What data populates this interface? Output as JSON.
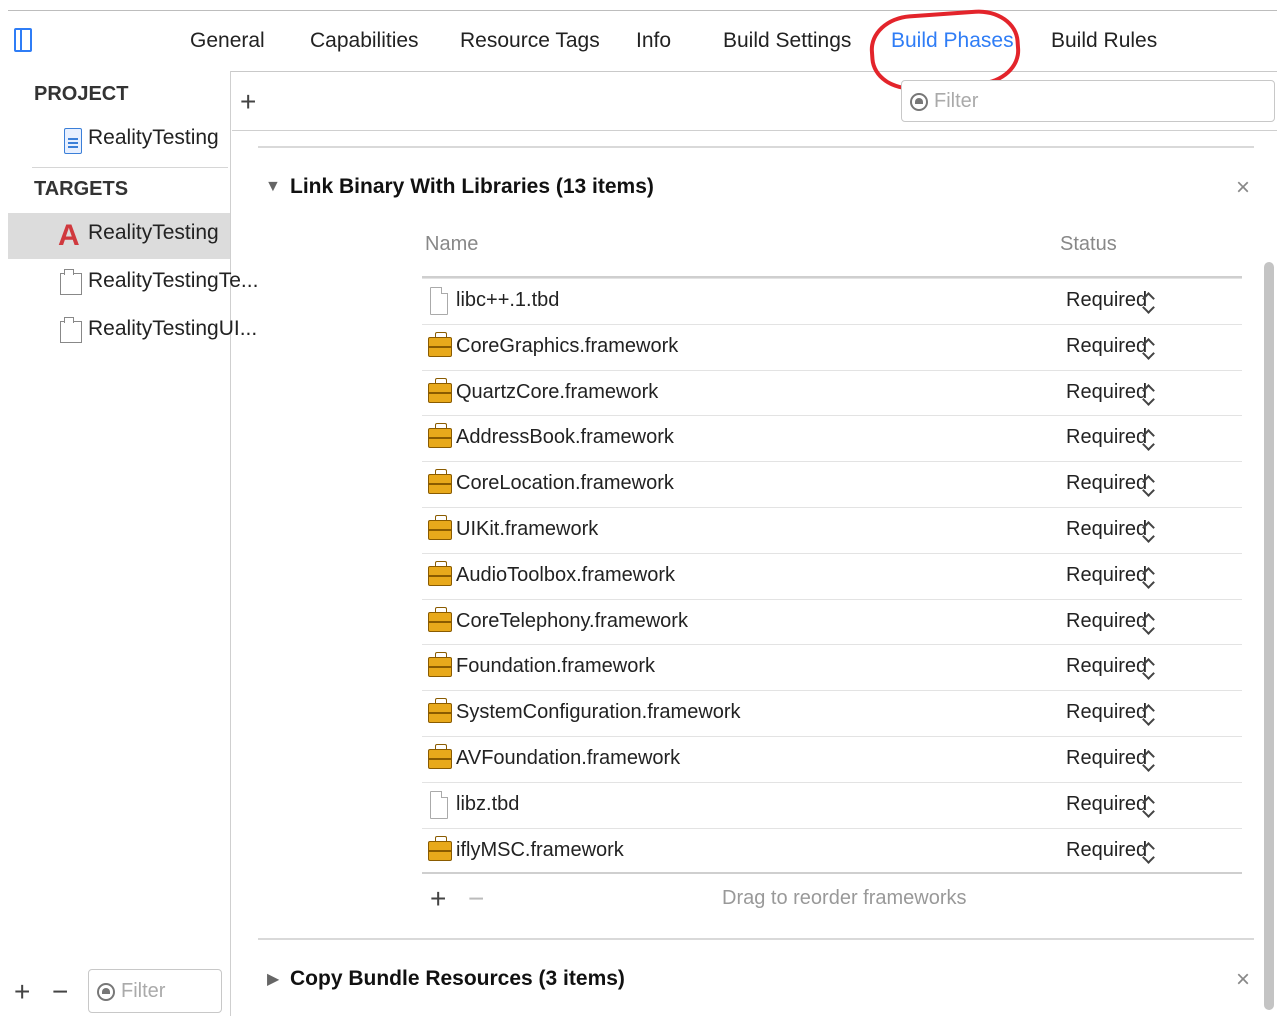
{
  "tabs": [
    {
      "label": "General"
    },
    {
      "label": "Capabilities"
    },
    {
      "label": "Resource Tags"
    },
    {
      "label": "Info"
    },
    {
      "label": "Build Settings"
    },
    {
      "label": "Build Phases",
      "active": true
    },
    {
      "label": "Build Rules"
    }
  ],
  "sidebar": {
    "project_header": "PROJECT",
    "project_name": "RealityTesting",
    "targets_header": "TARGETS",
    "targets": [
      {
        "label": "RealityTesting",
        "selected": true
      },
      {
        "label": "RealityTestingTe..."
      },
      {
        "label": "RealityTestingUI..."
      }
    ],
    "filter_placeholder": "Filter",
    "add_symbol": "+",
    "remove_symbol": "−"
  },
  "main": {
    "add_symbol": "+",
    "filter_placeholder": "Filter",
    "link_phase": {
      "title": "Link Binary With Libraries (13 items)",
      "close_symbol": "×",
      "col_name": "Name",
      "col_status": "Status",
      "items": [
        {
          "name": "libc++.1.tbd",
          "status": "Required",
          "icon": "file-icon"
        },
        {
          "name": "CoreGraphics.framework",
          "status": "Required",
          "icon": "framework-icon"
        },
        {
          "name": "QuartzCore.framework",
          "status": "Required",
          "icon": "framework-icon"
        },
        {
          "name": "AddressBook.framework",
          "status": "Required",
          "icon": "framework-icon"
        },
        {
          "name": "CoreLocation.framework",
          "status": "Required",
          "icon": "framework-icon"
        },
        {
          "name": "UIKit.framework",
          "status": "Required",
          "icon": "framework-icon"
        },
        {
          "name": "AudioToolbox.framework",
          "status": "Required",
          "icon": "framework-icon"
        },
        {
          "name": "CoreTelephony.framework",
          "status": "Required",
          "icon": "framework-icon"
        },
        {
          "name": "Foundation.framework",
          "status": "Required",
          "icon": "framework-icon"
        },
        {
          "name": "SystemConfiguration.framework",
          "status": "Required",
          "icon": "framework-icon"
        },
        {
          "name": "AVFoundation.framework",
          "status": "Required",
          "icon": "framework-icon"
        },
        {
          "name": "libz.tbd",
          "status": "Required",
          "icon": "file-icon"
        },
        {
          "name": "iflyMSC.framework",
          "status": "Required",
          "icon": "framework-icon"
        }
      ],
      "add_symbol": "+",
      "remove_symbol": "−",
      "hint": "Drag to reorder frameworks"
    },
    "copy_phase": {
      "title": "Copy Bundle Resources (3 items)",
      "close_symbol": "×"
    }
  },
  "colors": {
    "accent": "#2f7df6",
    "highlight_circle": "#e3242b",
    "framework_icon": "#e8a91b"
  }
}
